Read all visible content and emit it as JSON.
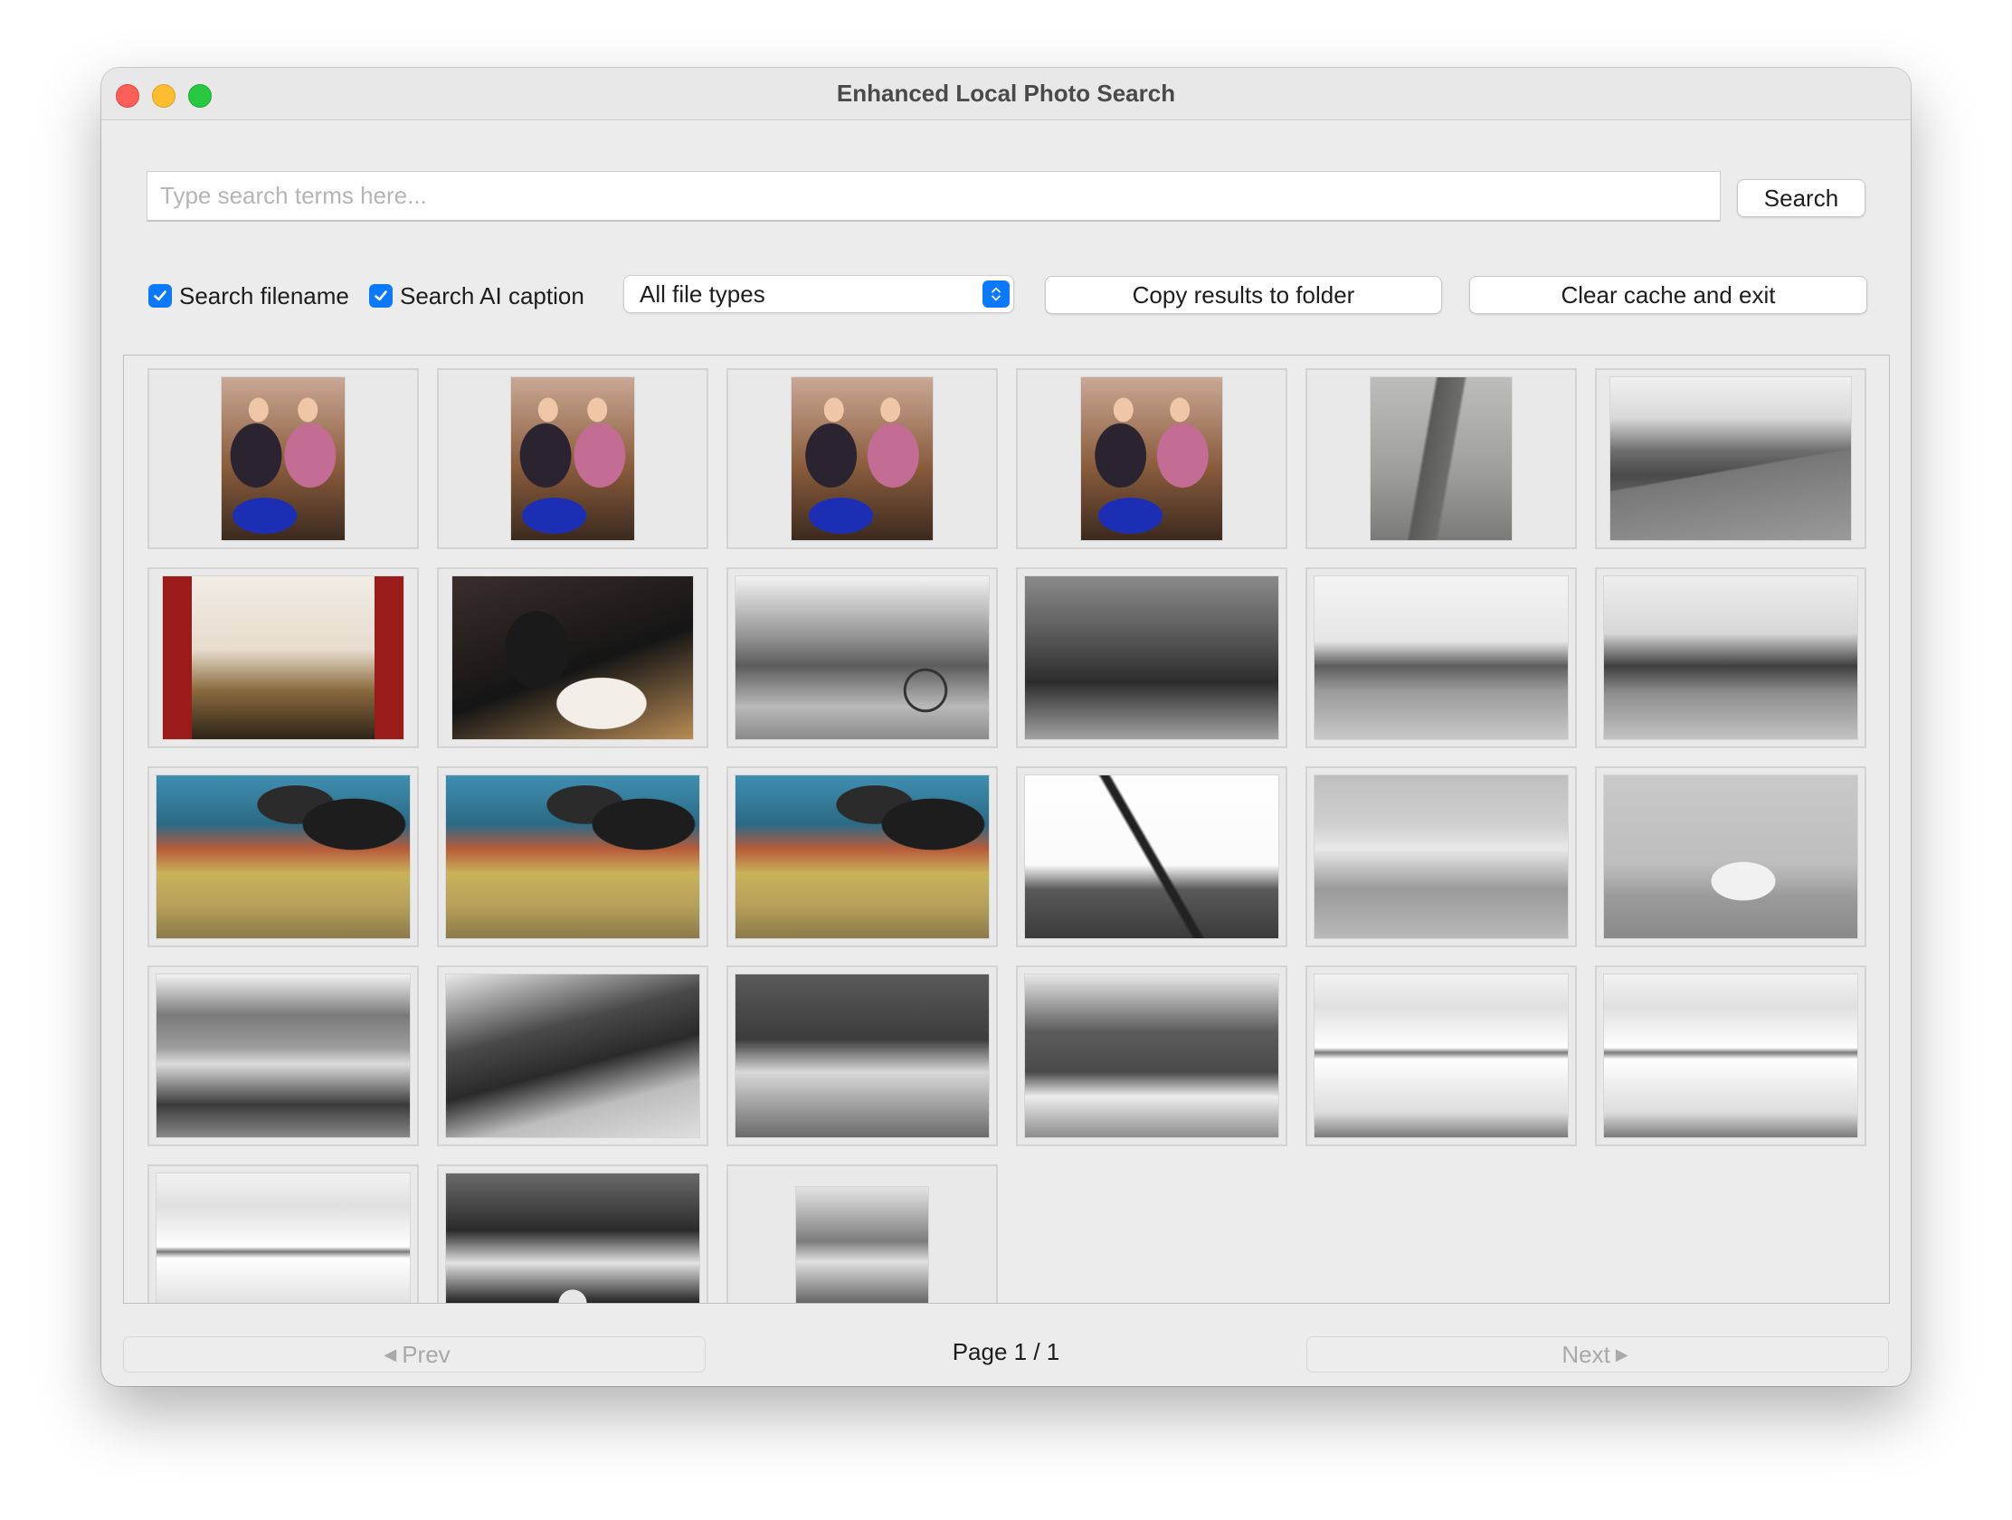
{
  "window": {
    "title": "Enhanced Local Photo Search"
  },
  "search": {
    "placeholder": "Type search terms here...",
    "value": "",
    "button_label": "Search"
  },
  "options": {
    "search_filename": {
      "label": "Search filename",
      "checked": true
    },
    "search_ai_caption": {
      "label": "Search AI caption",
      "checked": true
    },
    "file_type": {
      "selected": "All file types"
    },
    "copy_button_label": "Copy results to folder",
    "clear_button_label": "Clear cache and exit"
  },
  "results": {
    "thumbnails": [
      "two women with basket (color)",
      "two women with basket (color)",
      "two women with basket (color)",
      "two women with basket (color)",
      "aerial road (b&w)",
      "street procession (b&w)",
      "hall stage with red curtains (color)",
      "man signing book (color)",
      "horse and cart (b&w)",
      "workers with machinery (b&w)",
      "field with building (b&w)",
      "crowd in field (b&w)",
      "steam train (color)",
      "steam train (color)",
      "steam train (color)",
      "crane construction (b&w)",
      "hotel building (b&w)",
      "church building (b&w)",
      "thatched cottage (b&w)",
      "shed with vehicle (b&w)",
      "group of children (b&w)",
      "family by fence (b&w)",
      "stock & station agents building (b&w)",
      "stock & station agents building (b&w)",
      "stock & station agents building (b&w)",
      "band group (b&w)",
      "family portrait (b&w)"
    ]
  },
  "pagination": {
    "prev_label": "Prev",
    "next_label": "Next",
    "page_label": "Page 1 / 1",
    "prev_enabled": false,
    "next_enabled": false
  },
  "colors": {
    "accent": "#0a79ff",
    "close": "#fe5f57",
    "minimize": "#febc2e",
    "maximize": "#28c840"
  },
  "icons": {
    "check": "checkmark-icon",
    "select": "updown-chevron-icon",
    "prev": "left-triangle-icon",
    "next": "right-triangle-icon"
  }
}
